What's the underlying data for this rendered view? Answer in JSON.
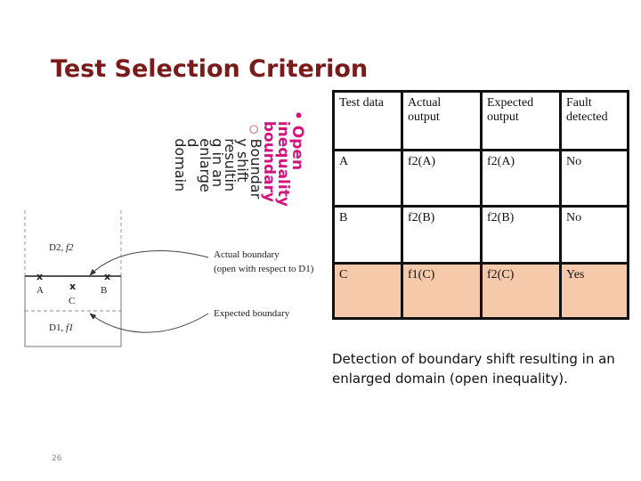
{
  "title": "Test Selection Criterion",
  "bullets": {
    "main": [
      "Open",
      "inequality",
      "boundary"
    ],
    "sub_marker": "○",
    "sub": [
      "Boundar",
      "y shift",
      "resultin",
      "g in an",
      "enlarge",
      "d",
      "domain"
    ]
  },
  "table": {
    "headers": [
      [
        "Test data"
      ],
      [
        "Actual",
        "output"
      ],
      [
        "Expected",
        "output"
      ],
      [
        "Fault",
        "detected"
      ]
    ],
    "rows": [
      [
        "A",
        "f2(A)",
        "f2(A)",
        "No"
      ],
      [
        "B",
        "f2(B)",
        "f2(B)",
        "No"
      ],
      [
        "C",
        "f1(C)",
        "f2(C)",
        "Yes"
      ]
    ],
    "highlight_color": "#f5c9a9"
  },
  "diagram": {
    "d2": "D2,",
    "f2": "f2",
    "d1": "D1,",
    "f1": "f1",
    "points": [
      "A",
      "B",
      "C"
    ],
    "actual": [
      "Actual boundary",
      "(open with respect to D1)"
    ],
    "expected": "Expected boundary"
  },
  "caption": "Detection of boundary shift resulting in an enlarged domain (open inequality).",
  "page_number": "26"
}
